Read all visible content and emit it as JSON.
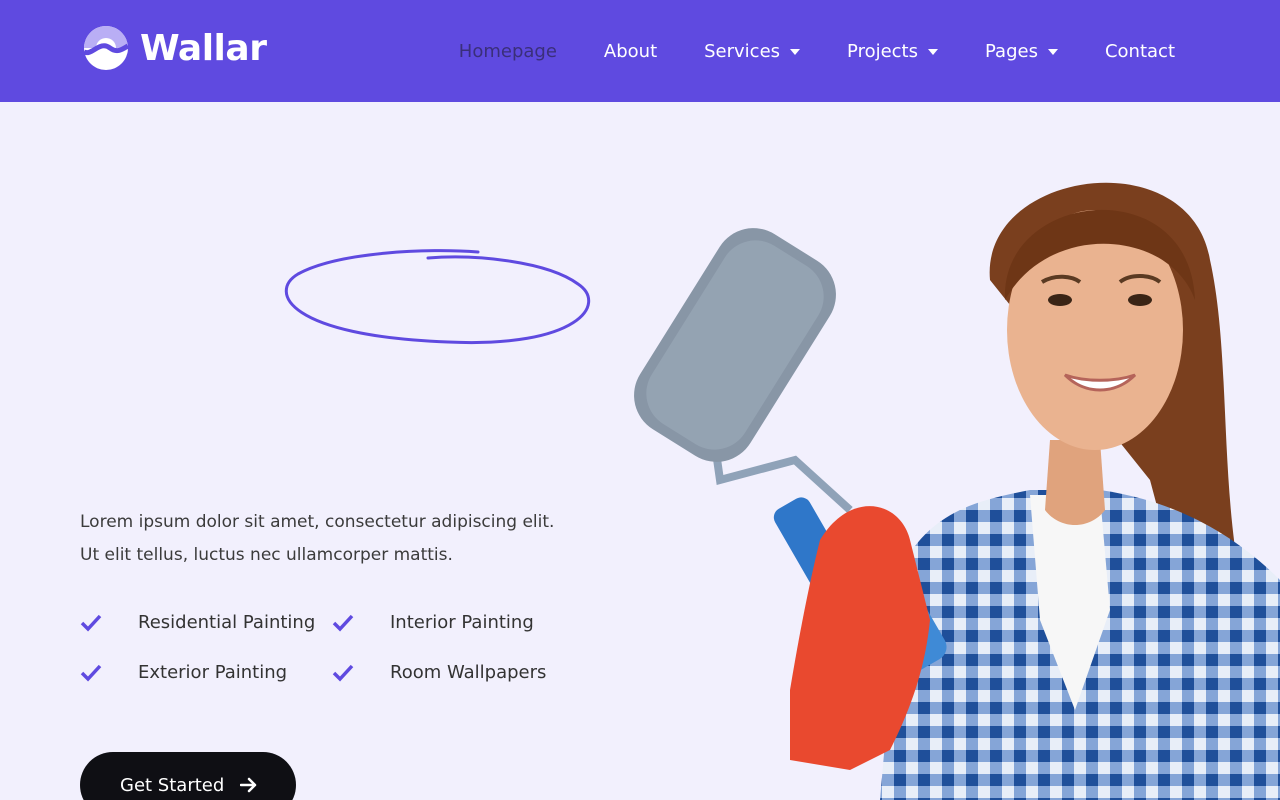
{
  "brand": {
    "name": "Wallar",
    "accent": "#5f4ae0",
    "background": "#f2f0fd"
  },
  "nav": {
    "items": [
      {
        "label": "Homepage",
        "active": true,
        "has_dropdown": false
      },
      {
        "label": "About",
        "active": false,
        "has_dropdown": false
      },
      {
        "label": "Services",
        "active": false,
        "has_dropdown": true
      },
      {
        "label": "Projects",
        "active": false,
        "has_dropdown": true
      },
      {
        "label": "Pages",
        "active": false,
        "has_dropdown": true
      },
      {
        "label": "Contact",
        "active": false,
        "has_dropdown": false
      }
    ]
  },
  "hero": {
    "description_line1": "Lorem ipsum dolor sit amet, consectetur adipiscing elit.",
    "description_line2": "Ut elit tellus, luctus nec ullamcorper mattis.",
    "features": [
      "Residential Painting",
      "Interior Painting",
      "Exterior Painting",
      "Room Wallpapers"
    ],
    "cta_label": "Get Started",
    "illustration": "woman holding paint roller"
  },
  "icons": {
    "check": "check-icon",
    "arrow": "arrow-right-icon",
    "caret": "chevron-down-icon"
  }
}
